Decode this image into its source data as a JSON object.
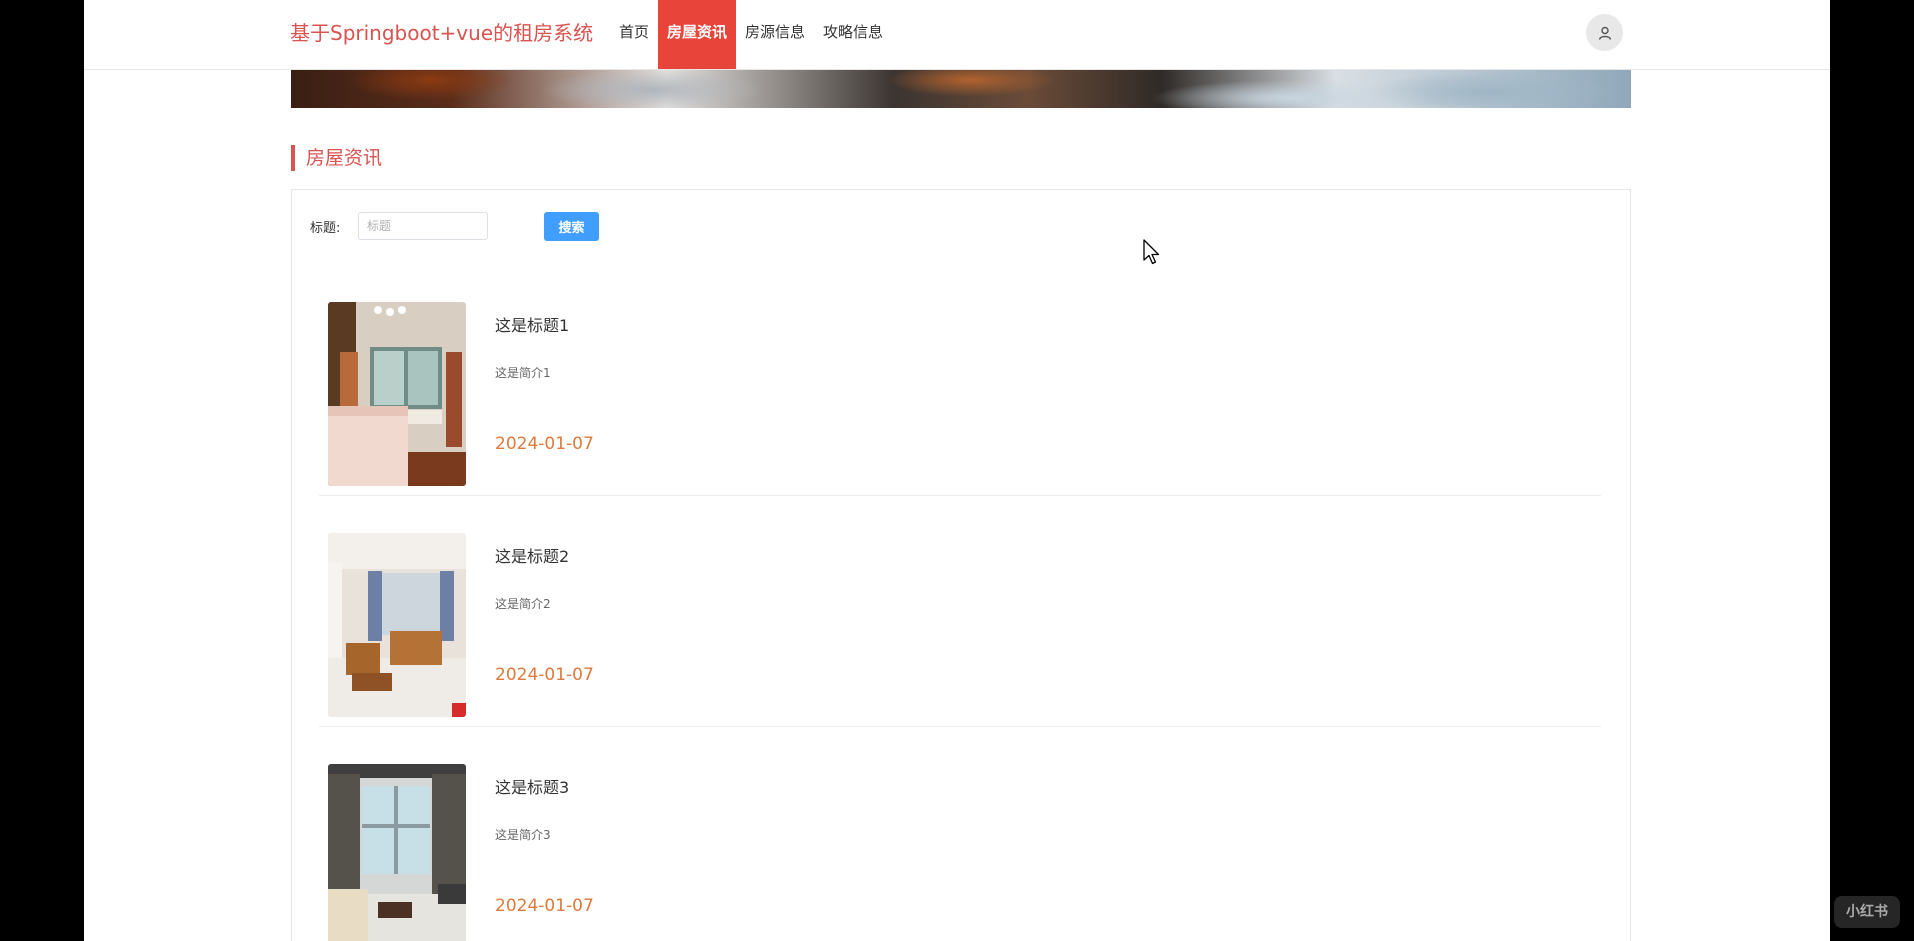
{
  "header": {
    "brand": "基于Springboot+vue的租房系统",
    "nav": [
      {
        "label": "首页",
        "active": false
      },
      {
        "label": "房屋资讯",
        "active": true
      },
      {
        "label": "房源信息",
        "active": false
      },
      {
        "label": "攻略信息",
        "active": false
      }
    ],
    "avatar_icon": "user-icon"
  },
  "section": {
    "title": "房屋资讯"
  },
  "search": {
    "label": "标题:",
    "placeholder": "标题",
    "value": "",
    "button_label": "搜索"
  },
  "news": [
    {
      "title": "这是标题1",
      "intro": "这是简介1",
      "date": "2024-01-07"
    },
    {
      "title": "这是标题2",
      "intro": "这是简介2",
      "date": "2024-01-07"
    },
    {
      "title": "这是标题3",
      "intro": "这是简介3",
      "date": "2024-01-07"
    }
  ],
  "colors": {
    "brand": "#d9534f",
    "nav_active_bg": "#e8443a",
    "button": "#409eff",
    "date": "#e07a3b"
  },
  "watermark": "小红书"
}
